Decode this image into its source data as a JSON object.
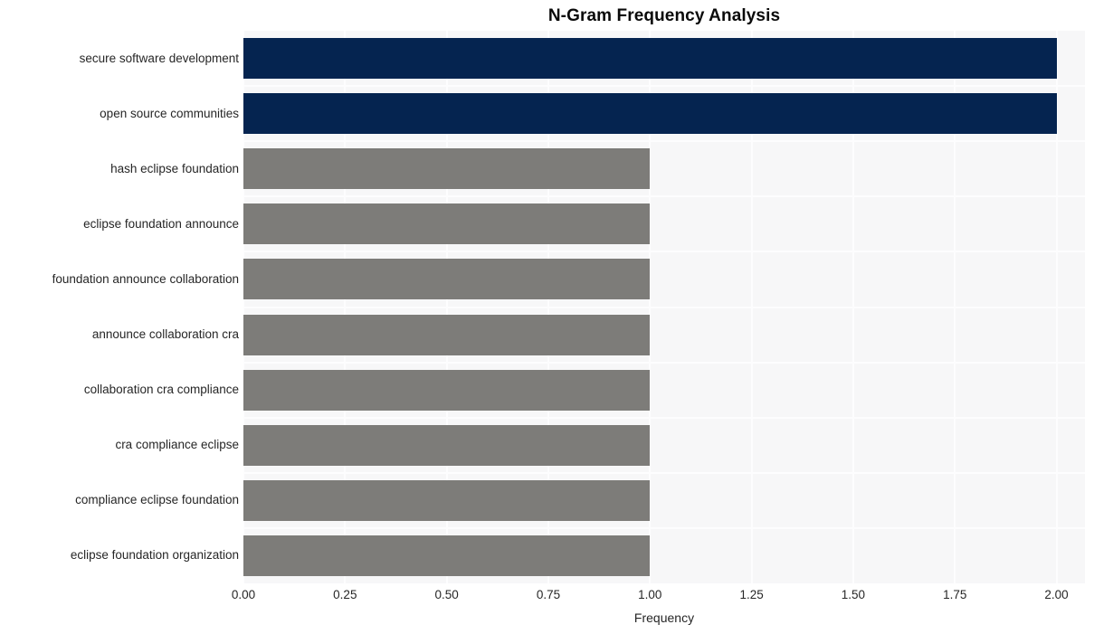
{
  "chart_data": {
    "type": "bar",
    "orientation": "horizontal",
    "title": "N-Gram Frequency Analysis",
    "xlabel": "Frequency",
    "ylabel": "",
    "categories": [
      "secure software development",
      "open source communities",
      "hash eclipse foundation",
      "eclipse foundation announce",
      "foundation announce collaboration",
      "announce collaboration cra",
      "collaboration cra compliance",
      "cra compliance eclipse",
      "compliance eclipse foundation",
      "eclipse foundation organization"
    ],
    "values": [
      2,
      2,
      1,
      1,
      1,
      1,
      1,
      1,
      1,
      1
    ],
    "bar_colors": [
      "#052450",
      "#052450",
      "#7d7c79",
      "#7d7c79",
      "#7d7c79",
      "#7d7c79",
      "#7d7c79",
      "#7d7c79",
      "#7d7c79",
      "#7d7c79"
    ],
    "xlim": [
      0,
      2.07
    ],
    "x_ticks": [
      0,
      0.25,
      0.5,
      0.75,
      1,
      1.25,
      1.5,
      1.75,
      2
    ],
    "x_tick_labels": [
      "0.00",
      "0.25",
      "0.50",
      "0.75",
      "1.00",
      "1.25",
      "1.50",
      "1.75",
      "2.00"
    ],
    "grid": true,
    "grid_color": "#fdfdfe",
    "legend": null,
    "plot_background": "#f7f7f8",
    "figure_background": "#ffffff",
    "highlight_color": "#052450",
    "base_color": "#7d7c79",
    "title_color": "#0a0a0a",
    "tick_label_color": "#262626"
  }
}
